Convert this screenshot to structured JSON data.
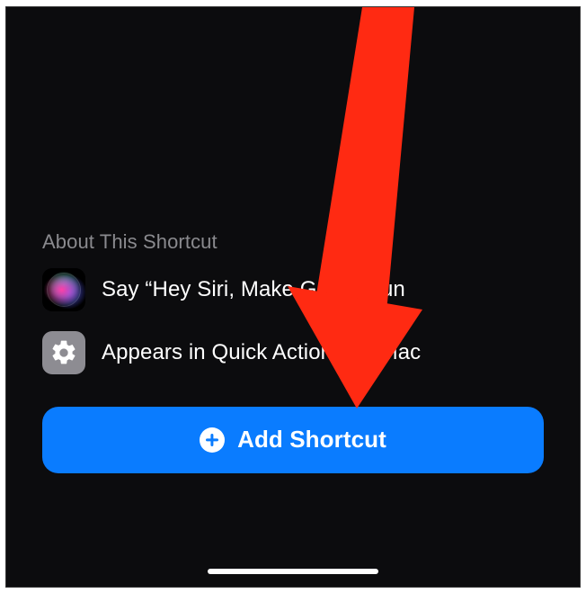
{
  "section": {
    "title": "About This Shortcut",
    "rows": [
      {
        "icon": "siri-icon",
        "text": "Say “Hey Siri, Make GIF” to run"
      },
      {
        "icon": "gear-icon",
        "text": "Appears in Quick Actions on Mac"
      }
    ]
  },
  "add_button": {
    "label": "Add Shortcut"
  },
  "overlay": {
    "arrow_color": "#ff2a12"
  }
}
